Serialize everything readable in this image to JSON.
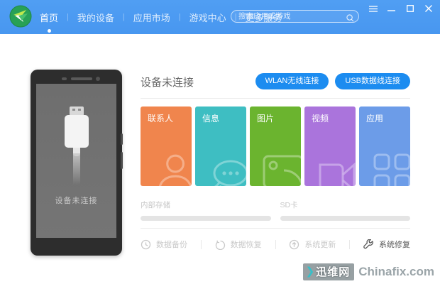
{
  "topbar": {
    "nav": [
      {
        "label": "首页",
        "active": true
      },
      {
        "label": "我的设备",
        "active": false
      },
      {
        "label": "应用市场",
        "active": false
      },
      {
        "label": "游戏中心",
        "active": false
      },
      {
        "label": "更多服务",
        "active": false
      }
    ],
    "search": {
      "placeholder": "搜索应用或游戏",
      "value": ""
    }
  },
  "phone": {
    "status_text": "设备未连接"
  },
  "panel": {
    "title": "设备未连接",
    "connect_buttons": [
      {
        "label": "WLAN无线连接"
      },
      {
        "label": "USB数据线连接"
      }
    ],
    "tiles": [
      {
        "label": "联系人",
        "color": "#F0854D",
        "icon": "contacts-icon"
      },
      {
        "label": "信息",
        "color": "#3EBEC2",
        "icon": "messages-icon"
      },
      {
        "label": "图片",
        "color": "#6BB42F",
        "icon": "pictures-icon"
      },
      {
        "label": "视频",
        "color": "#AA74DC",
        "icon": "videos-icon"
      },
      {
        "label": "应用",
        "color": "#6C9CE8",
        "icon": "apps-icon"
      }
    ],
    "storage": [
      {
        "label": "内部存储",
        "percent": 0
      },
      {
        "label": "SD卡",
        "percent": 0
      }
    ],
    "actions": [
      {
        "label": "数据备份",
        "enabled": false,
        "icon": "backup-icon"
      },
      {
        "label": "数据恢复",
        "enabled": false,
        "icon": "restore-icon"
      },
      {
        "label": "系统更新",
        "enabled": false,
        "icon": "update-icon"
      },
      {
        "label": "系统修复",
        "enabled": true,
        "icon": "repair-icon"
      }
    ]
  },
  "watermark": {
    "chevron": "❯",
    "site_name": "迅维网",
    "site_domain": "Chinafix.com"
  },
  "colors": {
    "topbar_blue": "#4B9BF2",
    "accent_button_blue": "#1C8CF0",
    "watermark_teal": "#35C0C9",
    "phone_frame": "#2D2D2D",
    "phone_screen": "#717171"
  }
}
